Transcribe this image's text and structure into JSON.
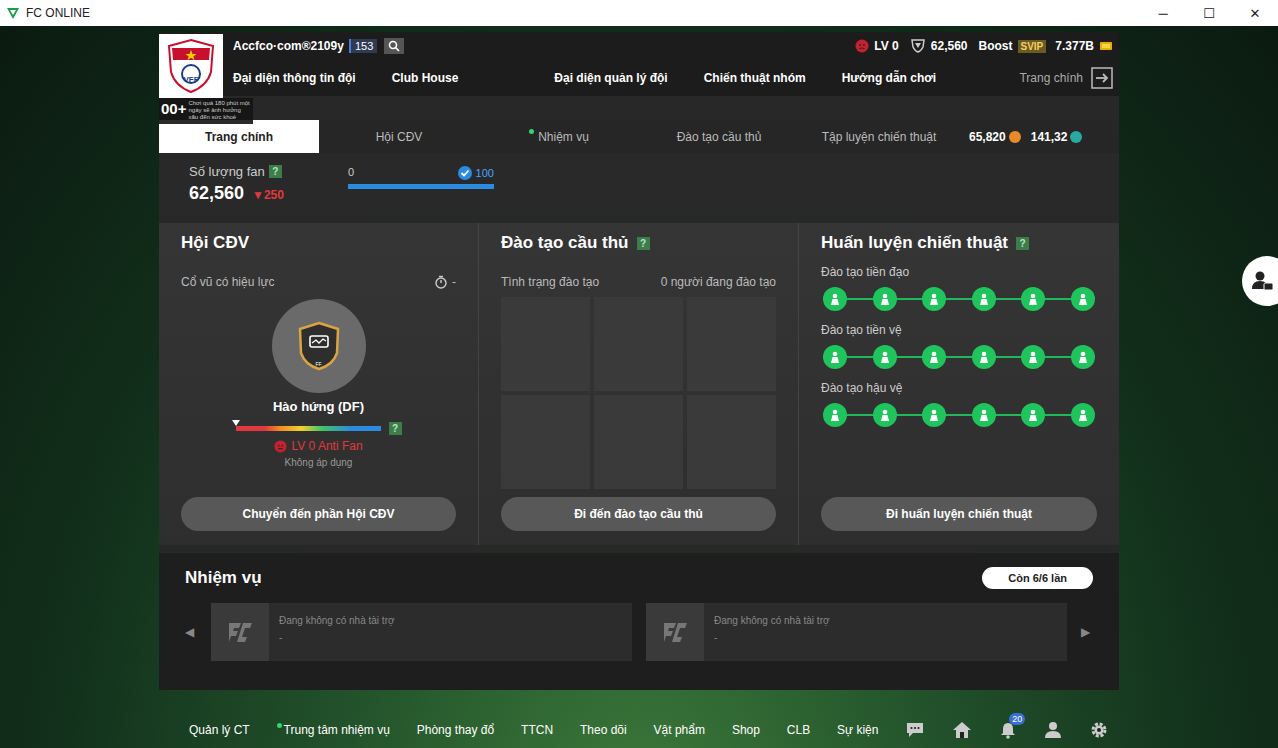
{
  "window": {
    "title": "FC ONLINE",
    "controls": [
      "─",
      "☐",
      "✕"
    ]
  },
  "header": {
    "logo_text": "VFF",
    "team_name": "Accfco·com®2109y",
    "team_level": "153",
    "level": "LV 0",
    "fans": "62,560",
    "boost": "Boost",
    "vip": "SVIP",
    "money": "7.377B"
  },
  "nav": [
    "Đại diện thông tin đội",
    "Club House",
    "Đại diện quản lý đội",
    "Chiến thuật nhóm",
    "Hướng dẫn chơi"
  ],
  "home_link": "Trang chính",
  "age_notice": {
    "rating": "00+",
    "text": "Chơi quá 180 phút một ngày sẽ ảnh hưởng xấu đến sức khoẻ"
  },
  "tabs": [
    {
      "label": "Trang chính",
      "selected": true,
      "dot": false
    },
    {
      "label": "Hội CĐV",
      "selected": false,
      "dot": false
    },
    {
      "label": "Nhiệm vụ",
      "selected": false,
      "dot": true
    },
    {
      "label": "Đào tạo cầu thủ",
      "selected": false,
      "dot": false
    },
    {
      "label": "Tập luyện chiến thuật",
      "selected": false,
      "dot": false
    }
  ],
  "currencies": [
    {
      "value": "65,820",
      "color": "#e8892b"
    },
    {
      "value": "141,32",
      "color": "#2aa9a0"
    }
  ],
  "fans": {
    "label": "Số lượng fan",
    "help": "?",
    "count": "62,560",
    "change": "▼250",
    "progress": {
      "min": "0",
      "max": "100",
      "level": 1,
      "reached": true
    }
  },
  "supporters": {
    "title": "Hội CĐV",
    "subtitle": "Cổ vũ có hiệu lực",
    "timer": "-",
    "badge_code": "FF",
    "badge_name": "Hào hứng (DF)",
    "mood_level": 0,
    "help": "?",
    "rank": "LV 0 Anti Fan",
    "status": "Không áp dụng",
    "button": "Chuyển đến phần Hội CĐV"
  },
  "player_training": {
    "title": "Đào tạo cầu thủ",
    "help": "?",
    "status_label": "Tình trạng đào tạo",
    "status_value": "0 người đang đào tạo",
    "slots": [
      {
        "occupied": false
      },
      {
        "occupied": false
      },
      {
        "occupied": false
      },
      {
        "occupied": false
      },
      {
        "occupied": false
      },
      {
        "occupied": false
      }
    ],
    "button": "Đi đến đào tạo cầu thủ"
  },
  "tactical": {
    "title": "Huấn luyện chiến thuật",
    "help": "?",
    "rows": [
      {
        "label": "Đào tạo tiền đạo",
        "nodes": [
          {
            "done": true
          },
          {
            "done": true
          },
          {
            "done": true
          },
          {
            "done": true
          },
          {
            "done": true
          },
          {
            "done": true
          }
        ]
      },
      {
        "label": "Đào tạo tiền vệ",
        "nodes": [
          {
            "done": true
          },
          {
            "done": true
          },
          {
            "done": true
          },
          {
            "done": true
          },
          {
            "done": true
          },
          {
            "done": true
          }
        ]
      },
      {
        "label": "Đào tạo hậu vệ",
        "nodes": [
          {
            "done": true
          },
          {
            "done": true
          },
          {
            "done": true
          },
          {
            "done": true
          },
          {
            "done": true
          },
          {
            "done": true
          }
        ]
      }
    ],
    "button": "Đi huấn luyện chiến thuật"
  },
  "missions": {
    "title": "Nhiệm vụ",
    "remaining": "Còn 6/6 lần",
    "prev": "◀",
    "next": "▶",
    "cards": [
      {
        "title": "Đang không có nhà tài trợ",
        "detail": "-"
      },
      {
        "title": "Đang không có nhà tài trợ",
        "detail": "-"
      }
    ]
  },
  "bottom_bar": {
    "items": [
      {
        "label": "Quản lý CT",
        "dot": false
      },
      {
        "label": "Trung tâm nhiệm vụ",
        "dot": true
      },
      {
        "label": "Phòng thay đổ",
        "dot": false
      },
      {
        "label": "TTCN",
        "dot": false
      },
      {
        "label": "Theo dõi",
        "dot": false
      },
      {
        "label": "Vật phẩm",
        "dot": false
      },
      {
        "label": "Shop",
        "dot": false
      },
      {
        "label": "CLB",
        "dot": false
      },
      {
        "label": "Sự kiện",
        "dot": false
      }
    ],
    "notifications": "20"
  }
}
